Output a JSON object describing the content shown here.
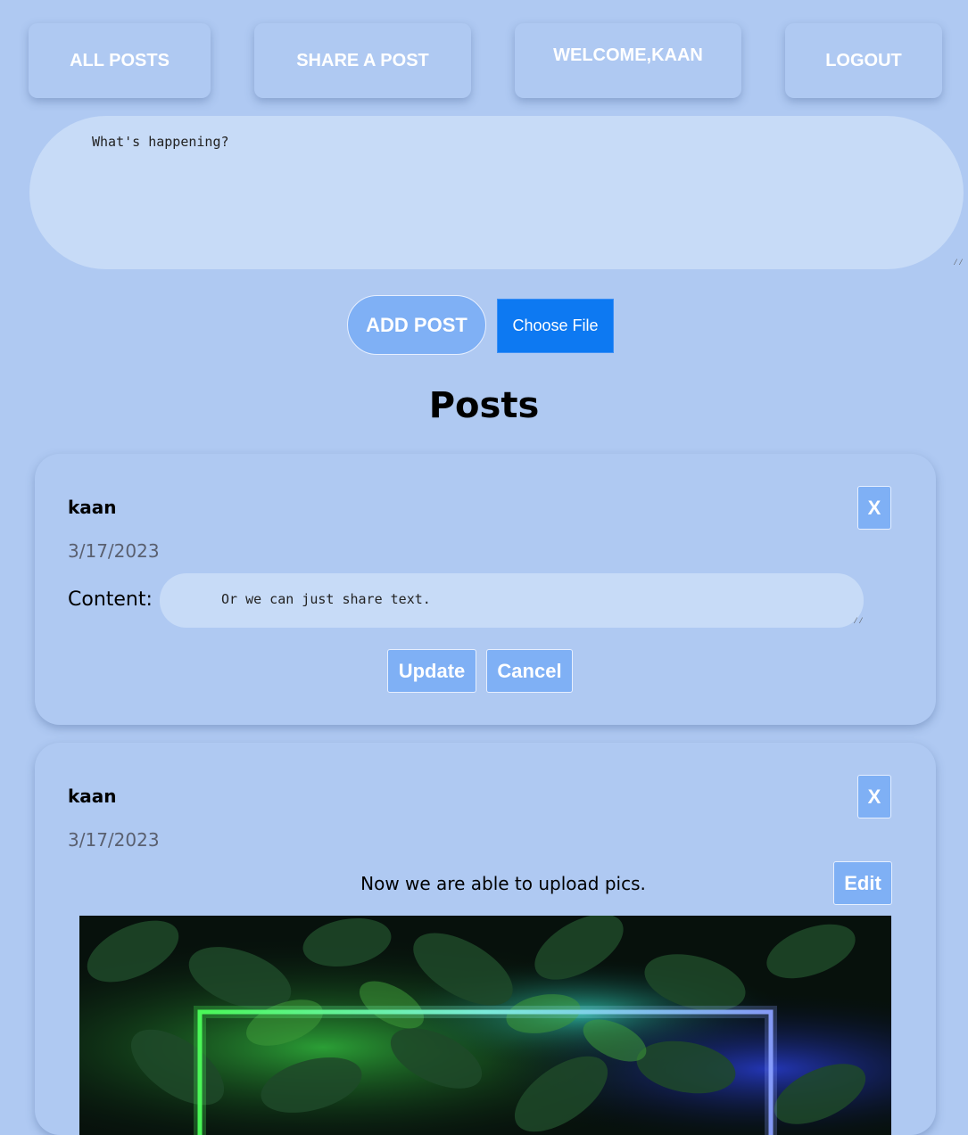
{
  "nav": {
    "all_posts": "ALL POSTS",
    "share_post": "SHARE A POST",
    "welcome": "WELCOME,KAAN",
    "logout": "LOGOUT"
  },
  "composer": {
    "placeholder": "What's happening?",
    "add_post_label": "ADD POST",
    "choose_file_label": "Choose File"
  },
  "posts_heading": "Posts",
  "posts": [
    {
      "author": "kaan",
      "date": "3/17/2023",
      "delete_label": "X",
      "content_label": "Content:",
      "content_value": "Or we can just share text.",
      "update_label": "Update",
      "cancel_label": "Cancel"
    },
    {
      "author": "kaan",
      "date": "3/17/2023",
      "delete_label": "X",
      "text": "Now we are able to upload pics.",
      "edit_label": "Edit"
    }
  ],
  "colors": {
    "background": "#afc9f2",
    "input_fill": "#c7dbf7",
    "button_fill": "#7fb0f5",
    "file_button": "#0d79f2"
  }
}
